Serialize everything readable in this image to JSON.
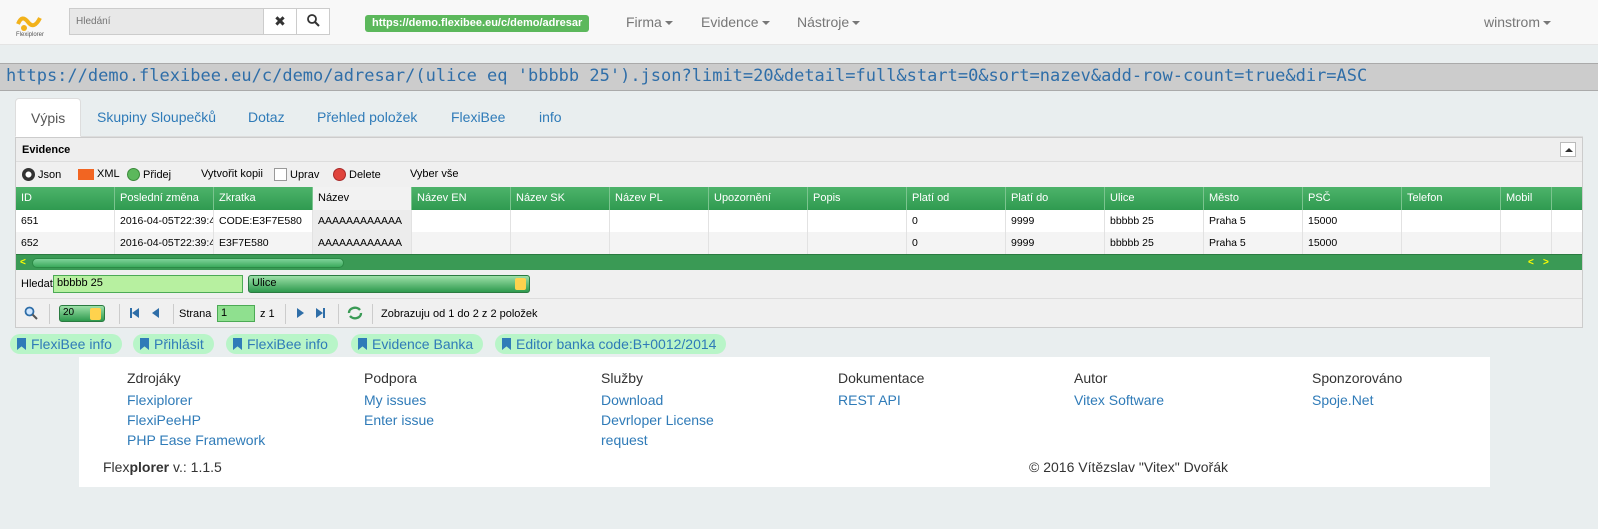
{
  "navbar": {
    "logo_text": "Flexiplorer",
    "search_placeholder": "Hledání",
    "clear_icon": "✖",
    "search_icon": "magnifier-icon",
    "url_badge": "https://demo.flexibee.eu/c/demo/adresar",
    "menus": [
      "Firma",
      "Evidence",
      "Nástroje"
    ],
    "user": "winstrom"
  },
  "query_url": "https://demo.flexibee.eu/c/demo/adresar/(ulice eq 'bbbbb 25').json?limit=20&detail=full&start=0&sort=nazev&add-row-count=true&dir=ASC",
  "tabs": [
    "Výpis",
    "Skupiny Sloupečků",
    "Dotaz",
    "Přehled položek",
    "FlexiBee",
    "info"
  ],
  "active_tab": "Výpis",
  "grid": {
    "title": "Evidence",
    "toolbar": {
      "json": "Json",
      "xml": "XML",
      "add": "Přidej",
      "copy": "Vytvořit kopii",
      "edit": "Uprav",
      "delete": "Delete",
      "select_all": "Vyber vše"
    },
    "columns": [
      "ID",
      "Poslední změna",
      "Zkratka",
      "Název",
      "Název EN",
      "Název SK",
      "Název PL",
      "Upozornění",
      "Popis",
      "Platí od",
      "Platí do",
      "Ulice",
      "Město",
      "PSČ",
      "Telefon",
      "Mobil"
    ],
    "sorted_column": "Název",
    "rows": [
      [
        "651",
        "2016-04-05T22:39:4",
        "CODE:E3F7E580",
        "AAAAAAAAAAAA",
        "",
        "",
        "",
        "",
        "",
        "0",
        "9999",
        "bbbbb 25",
        "Praha 5",
        "15000",
        "",
        ""
      ],
      [
        "652",
        "2016-04-05T22:39:4",
        "E3F7E580",
        "AAAAAAAAAAAA",
        "",
        "",
        "",
        "",
        "",
        "0",
        "9999",
        "bbbbb 25",
        "Praha 5",
        "15000",
        "",
        ""
      ]
    ],
    "search": {
      "label": "Hledat",
      "value": "bbbbb 25",
      "field": "Ulice"
    },
    "pager": {
      "page_size": "20",
      "page_label": "Strana",
      "page": "1",
      "of_label": "z 1",
      "status": "Zobrazuju od 1 do 2 z 2 položek"
    }
  },
  "bookmarks": [
    "FlexiBee info",
    "Přihlásit",
    "FlexiBee info",
    "Evidence Banka",
    "Editor banka code:B+0012/2014"
  ],
  "footer": {
    "columns": [
      {
        "heading": "Zdrojáky",
        "links": [
          "Flexiplorer",
          "FlexiPeeHP",
          "PHP Ease Framework"
        ]
      },
      {
        "heading": "Podpora",
        "links": [
          "My issues",
          "Enter issue"
        ]
      },
      {
        "heading": "Služby",
        "links": [
          "Download",
          "Devrloper License",
          "request"
        ]
      },
      {
        "heading": "Dokumentace",
        "links": [
          "REST API"
        ]
      },
      {
        "heading": "Autor",
        "links": [
          "Vitex Software"
        ]
      },
      {
        "heading": "Sponzorováno",
        "links": [
          "Spoje.Net"
        ]
      }
    ],
    "version_prefix": "Flex",
    "version_bold": "plorer",
    "version_suffix": " v.: 1.1.5",
    "copyright": "© 2016 Vítězslav \"Vitex\" Dvořák"
  },
  "colors": {
    "accent": "#2f7bb8",
    "grid_header": "#3aa65a",
    "badge": "#5cb85c",
    "bookmark_bg": "#b8f5c8"
  }
}
